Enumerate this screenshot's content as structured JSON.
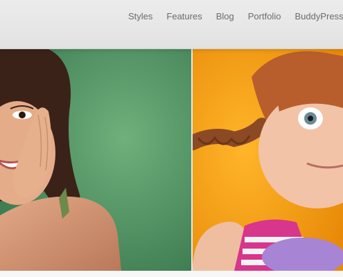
{
  "nav": {
    "items": [
      "Styles",
      "Features",
      "Blog",
      "Portfolio",
      "BuddyPress"
    ]
  },
  "colors": {
    "header_bg": "#e6e6e6",
    "nav_text": "#6b6b6b",
    "left_photo_bg": "#5fa06e",
    "right_photo_bg": "#f6a319"
  },
  "hero": {
    "slides": [
      {
        "subject": "smiling woman with hand on cheek, green backdrop"
      },
      {
        "subject": "red-haired girl with braids, orange backdrop"
      }
    ]
  }
}
